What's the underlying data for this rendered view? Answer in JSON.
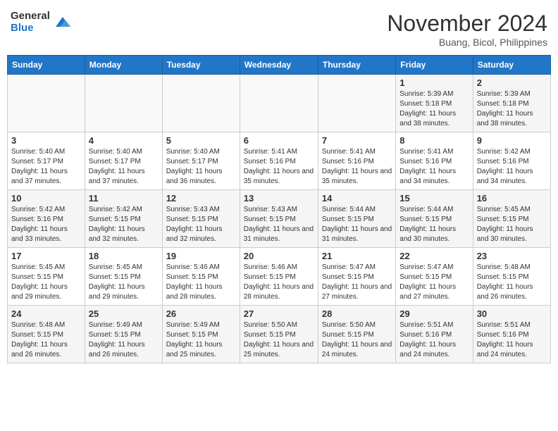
{
  "logo": {
    "general": "General",
    "blue": "Blue"
  },
  "title": "November 2024",
  "location": "Buang, Bicol, Philippines",
  "days_header": [
    "Sunday",
    "Monday",
    "Tuesday",
    "Wednesday",
    "Thursday",
    "Friday",
    "Saturday"
  ],
  "weeks": [
    [
      {
        "day": "",
        "sunrise": "",
        "sunset": "",
        "daylight": ""
      },
      {
        "day": "",
        "sunrise": "",
        "sunset": "",
        "daylight": ""
      },
      {
        "day": "",
        "sunrise": "",
        "sunset": "",
        "daylight": ""
      },
      {
        "day": "",
        "sunrise": "",
        "sunset": "",
        "daylight": ""
      },
      {
        "day": "",
        "sunrise": "",
        "sunset": "",
        "daylight": ""
      },
      {
        "day": "1",
        "sunrise": "Sunrise: 5:39 AM",
        "sunset": "Sunset: 5:18 PM",
        "daylight": "Daylight: 11 hours and 38 minutes."
      },
      {
        "day": "2",
        "sunrise": "Sunrise: 5:39 AM",
        "sunset": "Sunset: 5:18 PM",
        "daylight": "Daylight: 11 hours and 38 minutes."
      }
    ],
    [
      {
        "day": "3",
        "sunrise": "Sunrise: 5:40 AM",
        "sunset": "Sunset: 5:17 PM",
        "daylight": "Daylight: 11 hours and 37 minutes."
      },
      {
        "day": "4",
        "sunrise": "Sunrise: 5:40 AM",
        "sunset": "Sunset: 5:17 PM",
        "daylight": "Daylight: 11 hours and 37 minutes."
      },
      {
        "day": "5",
        "sunrise": "Sunrise: 5:40 AM",
        "sunset": "Sunset: 5:17 PM",
        "daylight": "Daylight: 11 hours and 36 minutes."
      },
      {
        "day": "6",
        "sunrise": "Sunrise: 5:41 AM",
        "sunset": "Sunset: 5:16 PM",
        "daylight": "Daylight: 11 hours and 35 minutes."
      },
      {
        "day": "7",
        "sunrise": "Sunrise: 5:41 AM",
        "sunset": "Sunset: 5:16 PM",
        "daylight": "Daylight: 11 hours and 35 minutes."
      },
      {
        "day": "8",
        "sunrise": "Sunrise: 5:41 AM",
        "sunset": "Sunset: 5:16 PM",
        "daylight": "Daylight: 11 hours and 34 minutes."
      },
      {
        "day": "9",
        "sunrise": "Sunrise: 5:42 AM",
        "sunset": "Sunset: 5:16 PM",
        "daylight": "Daylight: 11 hours and 34 minutes."
      }
    ],
    [
      {
        "day": "10",
        "sunrise": "Sunrise: 5:42 AM",
        "sunset": "Sunset: 5:16 PM",
        "daylight": "Daylight: 11 hours and 33 minutes."
      },
      {
        "day": "11",
        "sunrise": "Sunrise: 5:42 AM",
        "sunset": "Sunset: 5:15 PM",
        "daylight": "Daylight: 11 hours and 32 minutes."
      },
      {
        "day": "12",
        "sunrise": "Sunrise: 5:43 AM",
        "sunset": "Sunset: 5:15 PM",
        "daylight": "Daylight: 11 hours and 32 minutes."
      },
      {
        "day": "13",
        "sunrise": "Sunrise: 5:43 AM",
        "sunset": "Sunset: 5:15 PM",
        "daylight": "Daylight: 11 hours and 31 minutes."
      },
      {
        "day": "14",
        "sunrise": "Sunrise: 5:44 AM",
        "sunset": "Sunset: 5:15 PM",
        "daylight": "Daylight: 11 hours and 31 minutes."
      },
      {
        "day": "15",
        "sunrise": "Sunrise: 5:44 AM",
        "sunset": "Sunset: 5:15 PM",
        "daylight": "Daylight: 11 hours and 30 minutes."
      },
      {
        "day": "16",
        "sunrise": "Sunrise: 5:45 AM",
        "sunset": "Sunset: 5:15 PM",
        "daylight": "Daylight: 11 hours and 30 minutes."
      }
    ],
    [
      {
        "day": "17",
        "sunrise": "Sunrise: 5:45 AM",
        "sunset": "Sunset: 5:15 PM",
        "daylight": "Daylight: 11 hours and 29 minutes."
      },
      {
        "day": "18",
        "sunrise": "Sunrise: 5:45 AM",
        "sunset": "Sunset: 5:15 PM",
        "daylight": "Daylight: 11 hours and 29 minutes."
      },
      {
        "day": "19",
        "sunrise": "Sunrise: 5:46 AM",
        "sunset": "Sunset: 5:15 PM",
        "daylight": "Daylight: 11 hours and 28 minutes."
      },
      {
        "day": "20",
        "sunrise": "Sunrise: 5:46 AM",
        "sunset": "Sunset: 5:15 PM",
        "daylight": "Daylight: 11 hours and 28 minutes."
      },
      {
        "day": "21",
        "sunrise": "Sunrise: 5:47 AM",
        "sunset": "Sunset: 5:15 PM",
        "daylight": "Daylight: 11 hours and 27 minutes."
      },
      {
        "day": "22",
        "sunrise": "Sunrise: 5:47 AM",
        "sunset": "Sunset: 5:15 PM",
        "daylight": "Daylight: 11 hours and 27 minutes."
      },
      {
        "day": "23",
        "sunrise": "Sunrise: 5:48 AM",
        "sunset": "Sunset: 5:15 PM",
        "daylight": "Daylight: 11 hours and 26 minutes."
      }
    ],
    [
      {
        "day": "24",
        "sunrise": "Sunrise: 5:48 AM",
        "sunset": "Sunset: 5:15 PM",
        "daylight": "Daylight: 11 hours and 26 minutes."
      },
      {
        "day": "25",
        "sunrise": "Sunrise: 5:49 AM",
        "sunset": "Sunset: 5:15 PM",
        "daylight": "Daylight: 11 hours and 26 minutes."
      },
      {
        "day": "26",
        "sunrise": "Sunrise: 5:49 AM",
        "sunset": "Sunset: 5:15 PM",
        "daylight": "Daylight: 11 hours and 25 minutes."
      },
      {
        "day": "27",
        "sunrise": "Sunrise: 5:50 AM",
        "sunset": "Sunset: 5:15 PM",
        "daylight": "Daylight: 11 hours and 25 minutes."
      },
      {
        "day": "28",
        "sunrise": "Sunrise: 5:50 AM",
        "sunset": "Sunset: 5:15 PM",
        "daylight": "Daylight: 11 hours and 24 minutes."
      },
      {
        "day": "29",
        "sunrise": "Sunrise: 5:51 AM",
        "sunset": "Sunset: 5:16 PM",
        "daylight": "Daylight: 11 hours and 24 minutes."
      },
      {
        "day": "30",
        "sunrise": "Sunrise: 5:51 AM",
        "sunset": "Sunset: 5:16 PM",
        "daylight": "Daylight: 11 hours and 24 minutes."
      }
    ]
  ]
}
